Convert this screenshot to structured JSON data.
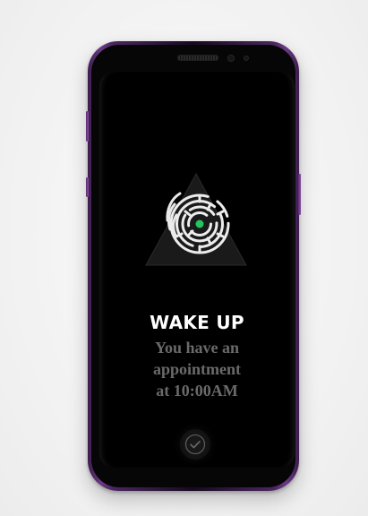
{
  "notification": {
    "title": "WAKE UP",
    "message_line1": "You have an",
    "message_line2": "appointment",
    "message_line3": "at 10:00AM"
  },
  "icons": {
    "logo": "maze-triangle-logo",
    "confirm": "check-circle-icon"
  },
  "colors": {
    "background": "#f4f4f4",
    "phone_frame": "#6a3a86",
    "screen": "#000000",
    "title": "#ffffff",
    "message": "#6a6a6a",
    "maze_dot": "#22c55e"
  }
}
